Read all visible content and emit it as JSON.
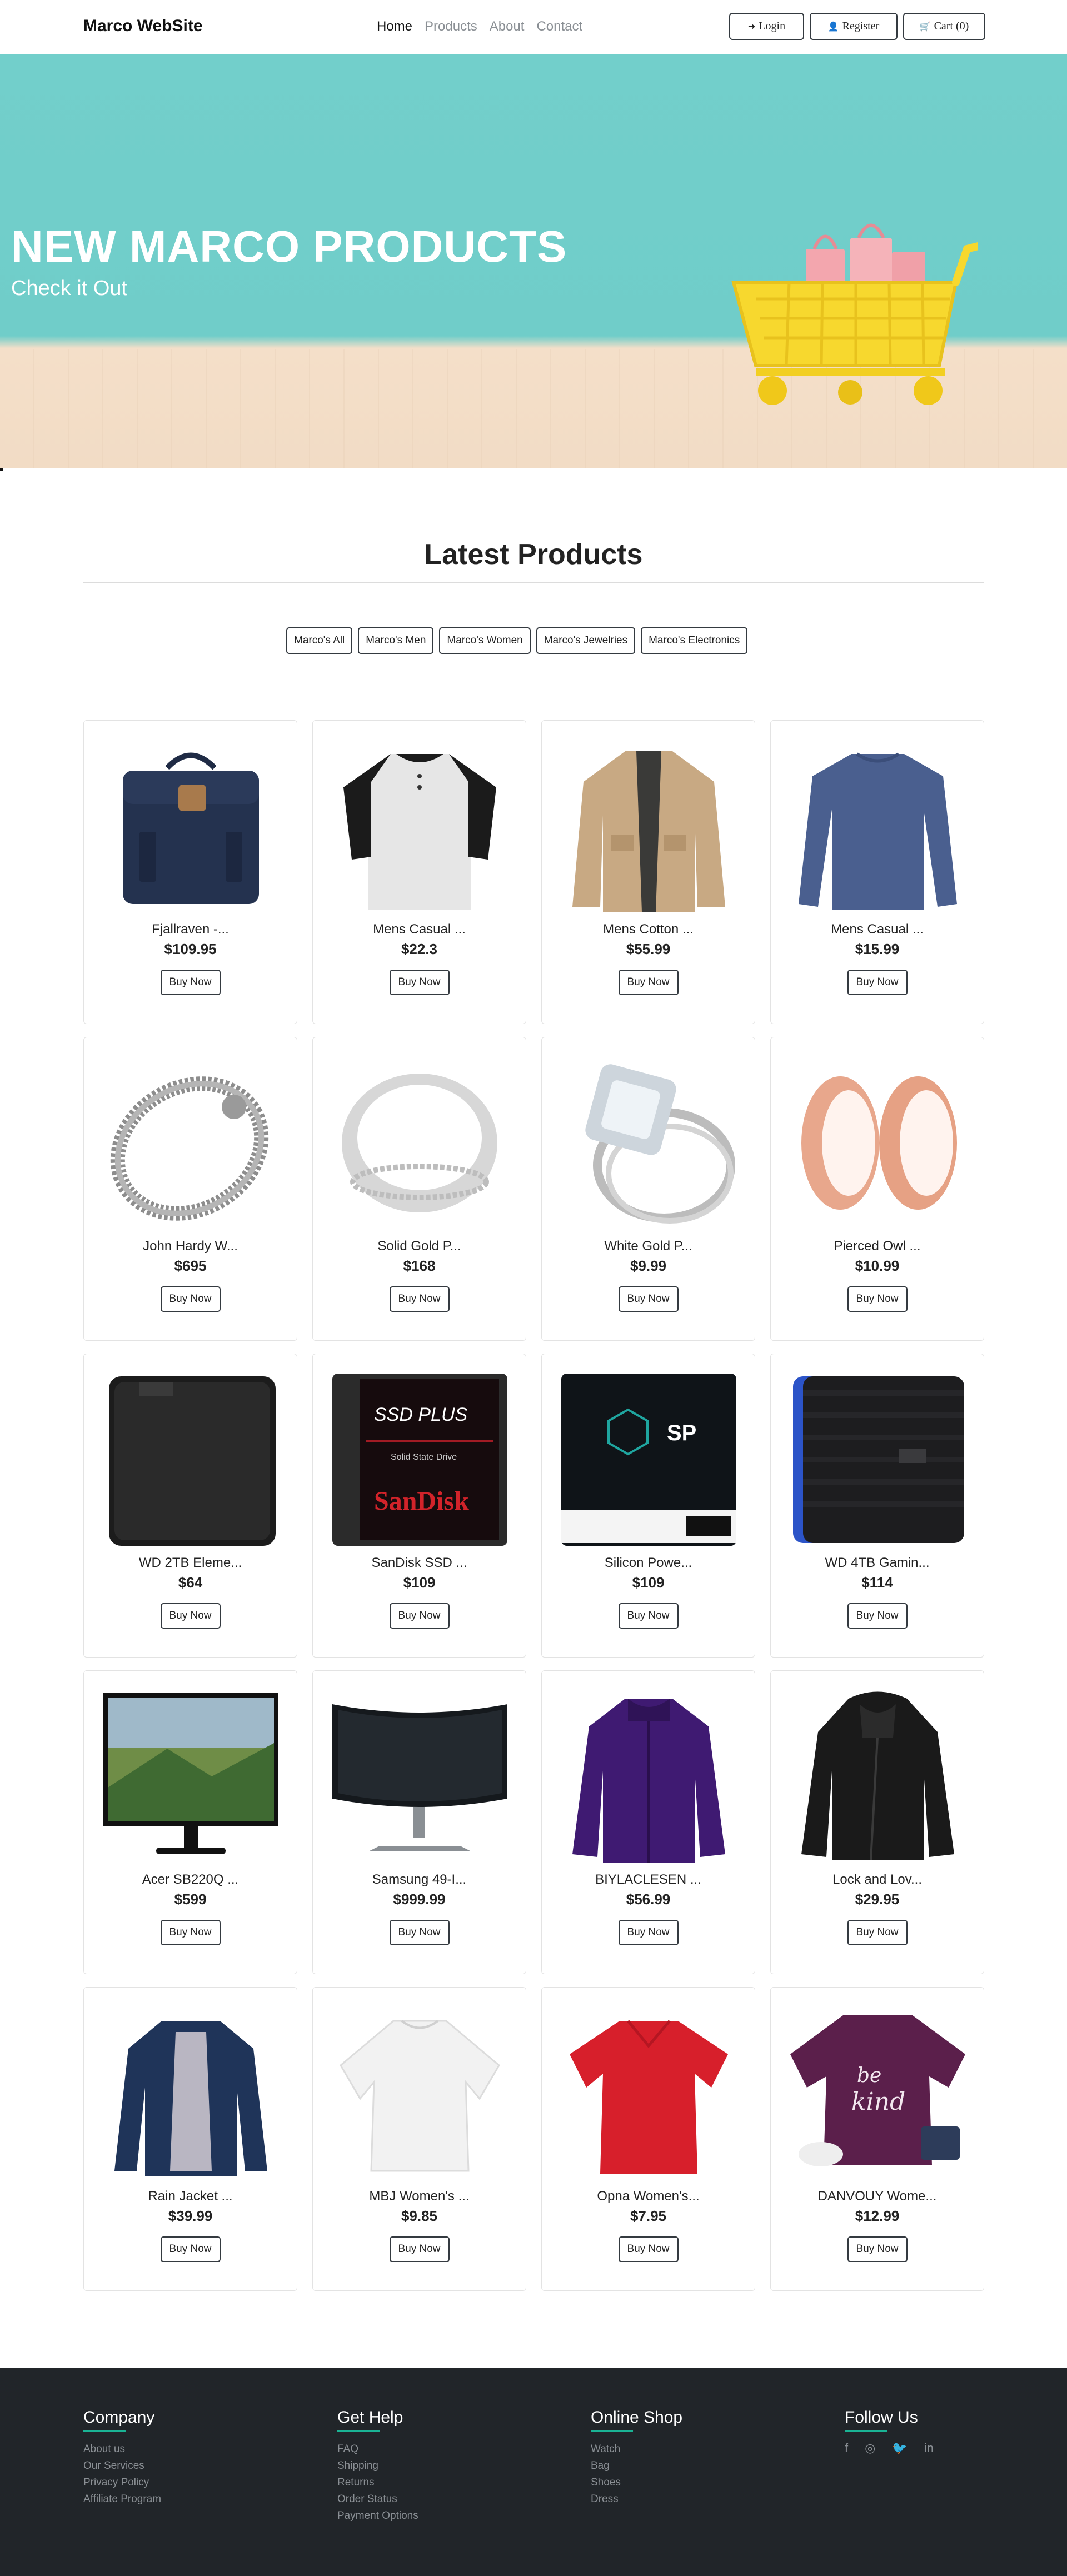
{
  "navbar": {
    "brand": "Marco WebSite",
    "links": [
      "Home",
      "Products",
      "About",
      "Contact"
    ],
    "buttons": {
      "login": "Login",
      "register": "Register",
      "cart": "Cart (0)"
    }
  },
  "hero": {
    "title": "NEW MARCO PRODUCTS",
    "subtitle": "Check it Out"
  },
  "section": {
    "title": "Latest Products"
  },
  "filters": [
    "Marco's All",
    "Marco's Men",
    "Marco's Women",
    "Marco's Jewelries",
    "Marco's Electronics"
  ],
  "products": [
    {
      "name": "Fjallraven -...",
      "price": "$109.95",
      "image": "backpack"
    },
    {
      "name": "Mens Casual ...",
      "price": "$22.3",
      "image": "henley-shirt"
    },
    {
      "name": "Mens Cotton ...",
      "price": "$55.99",
      "image": "cotton-jacket"
    },
    {
      "name": "Mens Casual ...",
      "price": "$15.99",
      "image": "slim-shirt"
    },
    {
      "name": "John Hardy W...",
      "price": "$695",
      "image": "dragon-bracelet"
    },
    {
      "name": "Solid Gold P...",
      "price": "$168",
      "image": "silver-ring"
    },
    {
      "name": "White Gold P...",
      "price": "$9.99",
      "image": "diamond-ring"
    },
    {
      "name": "Pierced Owl ...",
      "price": "$10.99",
      "image": "rose-gold-plugs"
    },
    {
      "name": "WD 2TB Eleme...",
      "price": "$64",
      "image": "external-hdd"
    },
    {
      "name": "SanDisk SSD ...",
      "price": "$109",
      "image": "sandisk-ssd"
    },
    {
      "name": "Silicon Powe...",
      "price": "$109",
      "image": "silicon-ssd"
    },
    {
      "name": "WD 4TB Gamin...",
      "price": "$114",
      "image": "gaming-drive"
    },
    {
      "name": "Acer SB220Q ...",
      "price": "$599",
      "image": "monitor"
    },
    {
      "name": "Samsung 49-I...",
      "price": "$999.99",
      "image": "curved-monitor"
    },
    {
      "name": "BIYLACLESEN ...",
      "price": "$56.99",
      "image": "purple-jacket"
    },
    {
      "name": "Lock and Lov...",
      "price": "$29.95",
      "image": "leather-jacket"
    },
    {
      "name": "Rain Jacket ...",
      "price": "$39.99",
      "image": "rain-jacket"
    },
    {
      "name": "MBJ Women's ...",
      "price": "$9.85",
      "image": "white-top"
    },
    {
      "name": "Opna Women's...",
      "price": "$7.95",
      "image": "red-tee"
    },
    {
      "name": "DANVOUY Wome...",
      "price": "$12.99",
      "image": "be-kind-tee"
    }
  ],
  "buy_label": "Buy Now",
  "footer": {
    "company": {
      "title": "Company",
      "links": [
        "About us",
        "Our Services",
        "Privacy Policy",
        "Affiliate Program"
      ]
    },
    "help": {
      "title": "Get Help",
      "links": [
        "FAQ",
        "Shipping",
        "Returns",
        "Order Status",
        "Payment Options"
      ]
    },
    "shop": {
      "title": "Online Shop",
      "links": [
        "Watch",
        "Bag",
        "Shoes",
        "Dress"
      ]
    },
    "follow": {
      "title": "Follow Us",
      "icons": [
        "facebook-icon",
        "instagram-icon",
        "twitter-icon",
        "linkedin-icon"
      ]
    }
  },
  "colors": {
    "hero_teal": "#70cdc9",
    "footer_bg": "#212529",
    "footer_accent": "#1ab394"
  }
}
